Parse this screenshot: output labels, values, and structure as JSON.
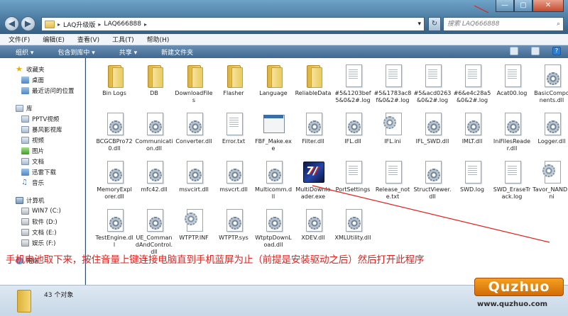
{
  "window": {
    "minimize_glyph": "—",
    "maximize_glyph": "▢",
    "close_glyph": "✕"
  },
  "nav": {
    "back_glyph": "◀",
    "forward_glyph": "▶",
    "history_glyph": "▾",
    "refresh_glyph": "↻"
  },
  "address": {
    "segments": [
      "LAQ升级版",
      "LAQ666888"
    ],
    "separator": "▸",
    "dropdown_glyph": "▾"
  },
  "search": {
    "placeholder": "搜索 LAQ666888",
    "glyph": "⌕"
  },
  "menu": [
    "文件(F)",
    "编辑(E)",
    "查看(V)",
    "工具(T)",
    "帮助(H)"
  ],
  "commands": [
    "组织 ▾",
    "包含到库中 ▾",
    "共享 ▾",
    "新建文件夹"
  ],
  "help_glyph": "?",
  "nav_pane": [
    {
      "label": "收藏夹",
      "icon": "star-icon",
      "level": "top"
    },
    {
      "label": "桌面",
      "icon": "desktop-icon",
      "level": "child"
    },
    {
      "label": "最近访问的位置",
      "icon": "recent-places-icon",
      "level": "child"
    },
    {
      "label": "",
      "level": "gap"
    },
    {
      "label": "库",
      "icon": "library-icon",
      "level": "top"
    },
    {
      "label": "PPTV视频",
      "icon": "video-library-icon",
      "level": "child"
    },
    {
      "label": "暴风影视库",
      "icon": "video-library-icon",
      "level": "child"
    },
    {
      "label": "视频",
      "icon": "video-library-icon",
      "level": "child"
    },
    {
      "label": "图片",
      "icon": "pictures-library-icon",
      "level": "child"
    },
    {
      "label": "文档",
      "icon": "documents-library-icon",
      "level": "child"
    },
    {
      "label": "迅雷下载",
      "icon": "download-library-icon",
      "level": "child"
    },
    {
      "label": "音乐",
      "icon": "music-icon",
      "level": "child"
    },
    {
      "label": "",
      "level": "gap"
    },
    {
      "label": "计算机",
      "icon": "computer-icon",
      "level": "top"
    },
    {
      "label": "WIN7 (C:)",
      "icon": "drive-icon",
      "level": "child"
    },
    {
      "label": "软件 (D:)",
      "icon": "drive-icon",
      "level": "child"
    },
    {
      "label": "文档 (E:)",
      "icon": "drive-icon",
      "level": "child"
    },
    {
      "label": "娱乐 (F:)",
      "icon": "drive-icon",
      "level": "child"
    },
    {
      "label": "",
      "level": "gap"
    },
    {
      "label": "网络",
      "icon": "network-icon",
      "level": "top"
    }
  ],
  "files": [
    {
      "name": "Bin Logs",
      "icon": "folder"
    },
    {
      "name": "DB",
      "icon": "folder"
    },
    {
      "name": "DownloadFiles",
      "icon": "folder"
    },
    {
      "name": "Flasher",
      "icon": "folder"
    },
    {
      "name": "Language",
      "icon": "folder"
    },
    {
      "name": "ReliableData",
      "icon": "folder"
    },
    {
      "name": "#5&1203bef5&0&2#.log",
      "icon": "doc"
    },
    {
      "name": "#5&1783ac8f&0&2#.log",
      "icon": "doc"
    },
    {
      "name": "#5&acd0263&0&2#.log",
      "icon": "doc"
    },
    {
      "name": "#6&e4c28a5&0&2#.log",
      "icon": "doc"
    },
    {
      "name": "Acat00.log",
      "icon": "doc"
    },
    {
      "name": "BasicComponents.dll",
      "icon": "gear"
    },
    {
      "name": "BCGCBPro720.dll",
      "icon": "gear"
    },
    {
      "name": "Communication.dll",
      "icon": "gear"
    },
    {
      "name": "Converter.dll",
      "icon": "gear"
    },
    {
      "name": "Error.txt",
      "icon": "doc"
    },
    {
      "name": "FBF_Make.exe",
      "icon": "exe"
    },
    {
      "name": "Filter.dll",
      "icon": "gear"
    },
    {
      "name": "IFL.dll",
      "icon": "gear"
    },
    {
      "name": "IFL.ini",
      "icon": "ini"
    },
    {
      "name": "IFL_SWD.dll",
      "icon": "gear"
    },
    {
      "name": "IMLT.dll",
      "icon": "gear"
    },
    {
      "name": "IniFilesReader.dll",
      "icon": "gear"
    },
    {
      "name": "Logger.dll",
      "icon": "gear"
    },
    {
      "name": "MemoryExplorer.dll",
      "icon": "gear"
    },
    {
      "name": "mfc42.dll",
      "icon": "gear"
    },
    {
      "name": "msvcirt.dll",
      "icon": "gear"
    },
    {
      "name": "msvcrt.dll",
      "icon": "gear"
    },
    {
      "name": "Multicomm.dll",
      "icon": "gear"
    },
    {
      "name": "MultiDownloader.exe",
      "icon": "app"
    },
    {
      "name": "PortSettings",
      "icon": "doc"
    },
    {
      "name": "Release_note.txt",
      "icon": "doc"
    },
    {
      "name": "StructViewer.dll",
      "icon": "gear"
    },
    {
      "name": "SWD.log",
      "icon": "doc"
    },
    {
      "name": "SWD_EraseTrack.log",
      "icon": "doc"
    },
    {
      "name": "Tavor_NAND.ini",
      "icon": "ini"
    },
    {
      "name": "TestEngine.dll",
      "icon": "gear"
    },
    {
      "name": "UE_CommandAndControl.dll",
      "icon": "gear"
    },
    {
      "name": "WTPTP.INF",
      "icon": "ini"
    },
    {
      "name": "WTPTP.sys",
      "icon": "gear"
    },
    {
      "name": "WtptpDownLoad.dll",
      "icon": "gear"
    },
    {
      "name": "XDEV.dll",
      "icon": "gear"
    },
    {
      "name": "XMLUtility.dll",
      "icon": "gear"
    }
  ],
  "status": {
    "item_count": "43 个对象"
  },
  "annotation": "手机电池取下来，按住音量上键连接电脑直到手机蓝屏为止（前提是安装驱动之后）然后打开此程序",
  "watermark": {
    "brand": "Quzhuo",
    "url": "www.quzhuo.com"
  },
  "colors": {
    "annotation_red": "#e0221e",
    "titlebar_blue": "#4f7fa5"
  }
}
